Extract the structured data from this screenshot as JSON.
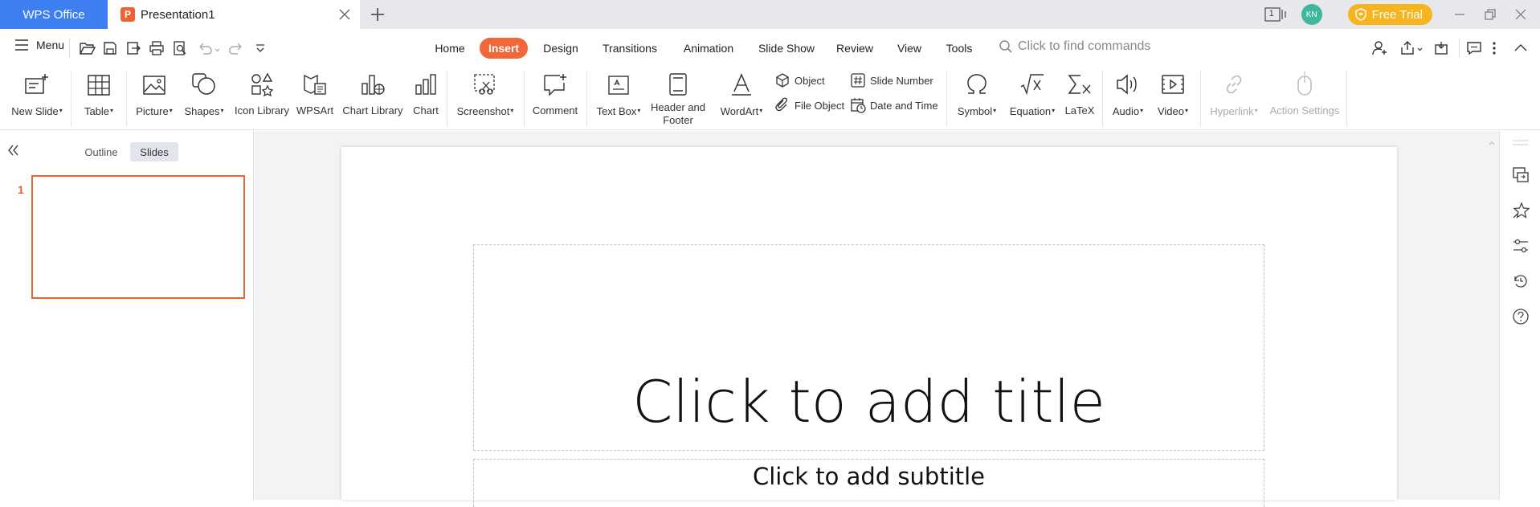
{
  "titlebar": {
    "app_tab": "WPS Office",
    "doc_tab": "Presentation1",
    "doc_icon_letter": "P",
    "avatar_initials": "KN",
    "free_trial": "Free Trial",
    "window_count": "1"
  },
  "menu": {
    "label": "Menu",
    "tabs": [
      "Home",
      "Insert",
      "Design",
      "Transitions",
      "Animation",
      "Slide Show",
      "Review",
      "View",
      "Tools"
    ],
    "active_tab": "Insert",
    "find_placeholder": "Click to find commands"
  },
  "ribbon": {
    "new_slide": "New Slide",
    "table": "Table",
    "picture": "Picture",
    "shapes": "Shapes",
    "icon_library": "Icon Library",
    "wpsart": "WPSArt",
    "chart_library": "Chart Library",
    "chart": "Chart",
    "screenshot": "Screenshot",
    "comment": "Comment",
    "text_box": "Text Box",
    "header_footer_1": "Header and",
    "header_footer_2": "Footer",
    "wordart": "WordArt",
    "object": "Object",
    "file_object": "File Object",
    "slide_number": "Slide Number",
    "date_time": "Date and Time",
    "symbol": "Symbol",
    "equation": "Equation",
    "latex": "LaTeX",
    "audio": "Audio",
    "video": "Video",
    "hyperlink": "Hyperlink",
    "action_settings": "Action Settings"
  },
  "panel": {
    "outline_tab": "Outline",
    "slides_tab": "Slides",
    "slide_number": "1"
  },
  "slide": {
    "title_placeholder": "Click to add title",
    "subtitle_placeholder": "Click to add subtitle"
  },
  "colors": {
    "accent": "#f0683a",
    "wps_blue": "#3d7ff0",
    "free_trial": "#f6b41e",
    "avatar": "#3fb79d"
  }
}
